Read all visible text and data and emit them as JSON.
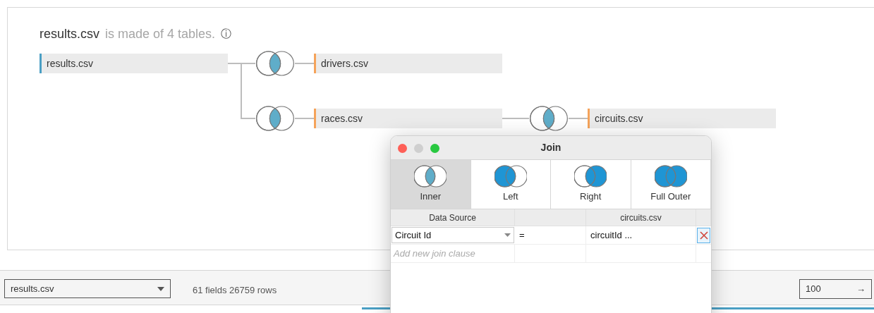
{
  "summary": {
    "table": "results.csv",
    "text": "is made of 4 tables.",
    "info_icon": "ⓘ"
  },
  "nodes": [
    {
      "label": "results.csv",
      "color": "#4a9fc4"
    },
    {
      "label": "drivers.csv",
      "color": "#f5a35a"
    },
    {
      "label": "races.csv",
      "color": "#f5a35a"
    },
    {
      "label": "circuits.csv",
      "color": "#f5a35a"
    }
  ],
  "links": [
    {
      "kind": "inner"
    },
    {
      "kind": "inner"
    },
    {
      "kind": "inner"
    }
  ],
  "join_dialog": {
    "title": "Join",
    "join_types": [
      {
        "kind": "inner",
        "label": "Inner",
        "selected": true
      },
      {
        "kind": "left",
        "label": "Left",
        "selected": false
      },
      {
        "kind": "right",
        "label": "Right",
        "selected": false
      },
      {
        "kind": "full",
        "label": "Full Outer",
        "selected": false
      }
    ],
    "columns": [
      "Data Source",
      "circuits.csv"
    ],
    "clauses": [
      {
        "left": "Circuit Id",
        "operator": "=",
        "right": "circuitId ..."
      }
    ],
    "add_placeholder": "Add new join clause"
  },
  "footer": {
    "table_select": "results.csv",
    "stats": "61 fields 26759 rows",
    "row_limit": "100",
    "go": "→"
  }
}
